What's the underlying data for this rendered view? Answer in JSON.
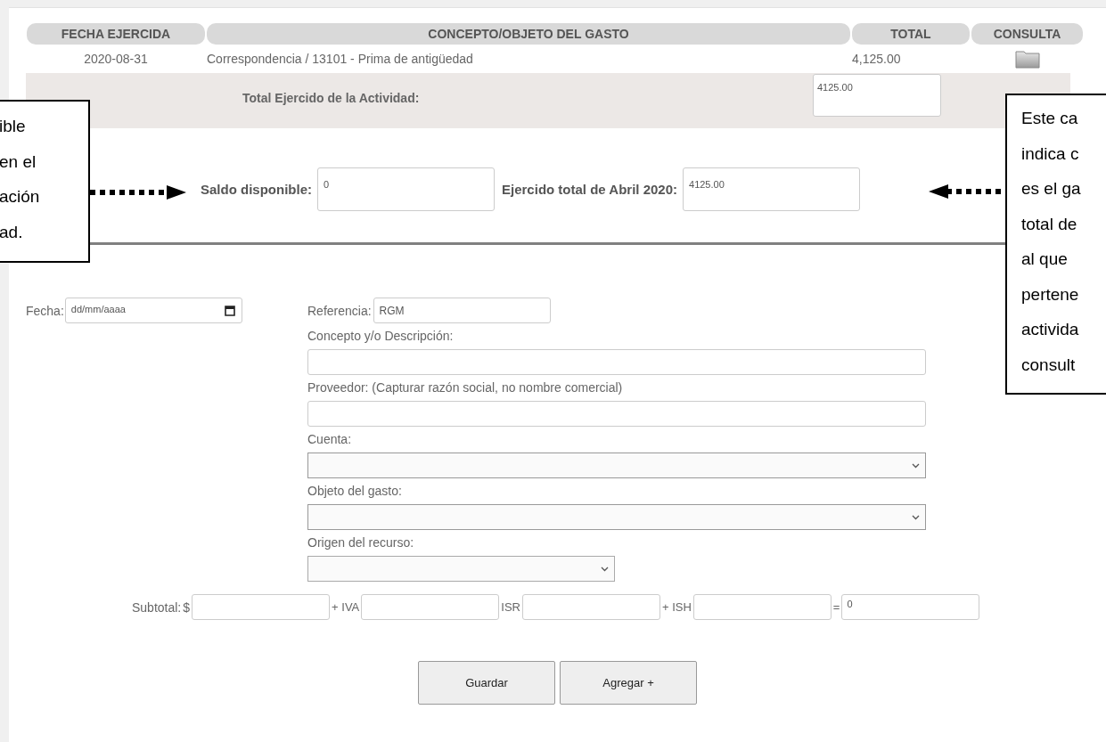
{
  "table": {
    "columns": [
      "FECHA EJERCIDA",
      "CONCEPTO/OBJETO DEL GASTO",
      "TOTAL",
      "CONSULTA"
    ],
    "rows": [
      {
        "fecha": "2020-08-31",
        "concepto": "Correspondencia / 13101 - Prima de antigüedad",
        "total": "4,125.00"
      }
    ],
    "total_label": "Total Ejercido de la Actividad:",
    "total_value": "4125.00"
  },
  "summary": [
    {
      "label": "Saldo disponible:",
      "value": "0"
    },
    {
      "label": "Ejercido total de Abril 2020:",
      "value": "4125.00"
    }
  ],
  "form": {
    "fecha": {
      "label": "Fecha:",
      "placeholder": "dd/mm/aaaa"
    },
    "referencia": {
      "label": "Referencia:",
      "value": "RGM"
    },
    "fields": [
      {
        "kind": "text",
        "label": "Concepto y/o Descripción:"
      },
      {
        "kind": "text",
        "label": "Proveedor: (Capturar razón social, no nombre comercial)"
      },
      {
        "kind": "select",
        "label": "Cuenta:"
      },
      {
        "kind": "select",
        "label": "Objeto del gasto:"
      },
      {
        "kind": "shortselect",
        "label": "Origen del recurso:"
      }
    ],
    "amounts": [
      {
        "label": "Subtotal:",
        "prefix": "$"
      },
      {
        "label": "+ IVA"
      },
      {
        "label": "ISR"
      },
      {
        "label": "+ ISH"
      },
      {
        "label": "=",
        "value": "0"
      }
    ],
    "buttons": [
      "Guardar",
      "Agregar +"
    ]
  },
  "callouts": [
    {
      "kind": "left",
      "text": "ible\nen el\nación\nad."
    },
    {
      "kind": "right",
      "text": "Este ca\nindica c\nes el ga\ntotal de\nal que\npertene\nactivida\nconsult"
    }
  ]
}
